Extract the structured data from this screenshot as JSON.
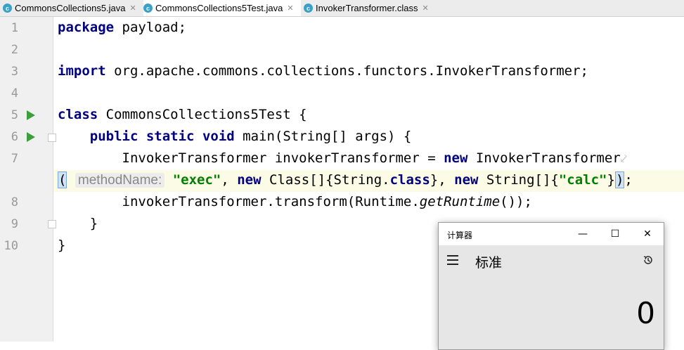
{
  "tabs": [
    {
      "label": "CommonsCollections5.java",
      "icon": "class-c-icon",
      "active": false
    },
    {
      "label": "CommonsCollections5Test.java",
      "icon": "class-c-icon",
      "active": true
    },
    {
      "label": "InvokerTransformer.class",
      "icon": "class-c-icon",
      "active": false
    }
  ],
  "editor": {
    "line_numbers": [
      "1",
      "2",
      "3",
      "4",
      "5",
      "6",
      "7",
      "8",
      "9",
      "10"
    ],
    "lines": {
      "l1_kw": "package",
      "l1_rest": " payload;",
      "l3_kw": "import",
      "l3_rest": " org.apache.commons.collections.functors.InvokerTransformer;",
      "l5_kw": "class",
      "l5_rest": " CommonsCollections5Test {",
      "l6_kw1": "public",
      "l6_kw2": "static",
      "l6_kw3": "void",
      "l6_rest": " main(String[] args) {",
      "l7_a": "InvokerTransformer invokerTransformer = ",
      "l7_kw": "new",
      "l7_b": " InvokerTransformer",
      "l7c_open": "(",
      "l7c_hint": "methodName:",
      "l7c_str1": "\"exec\"",
      "l7c_sep1": ", ",
      "l7c_kw1": "new",
      "l7c_mid1": " Class[]{String.",
      "l7c_kw2": "class",
      "l7c_mid2": "}, ",
      "l7c_kw3": "new",
      "l7c_mid3": " String[]{",
      "l7c_str2": "\"calc\"",
      "l7c_close1": "}",
      "l7c_close2": ")",
      "l7c_semi": ";",
      "l8_a": "invokerTransformer.transform(Runtime.",
      "l8_it": "getRuntime",
      "l8_b": "());",
      "l9": "}",
      "l10": "}"
    }
  },
  "calculator": {
    "title": "计算器",
    "minimize": "—",
    "maximize": "☐",
    "close": "✕",
    "mode": "标准",
    "display": "0"
  },
  "colors": {
    "keyword": "#000080",
    "string": "#008000",
    "run_icon": "#3c9e3c",
    "class_icon": "#3aa0c8"
  }
}
